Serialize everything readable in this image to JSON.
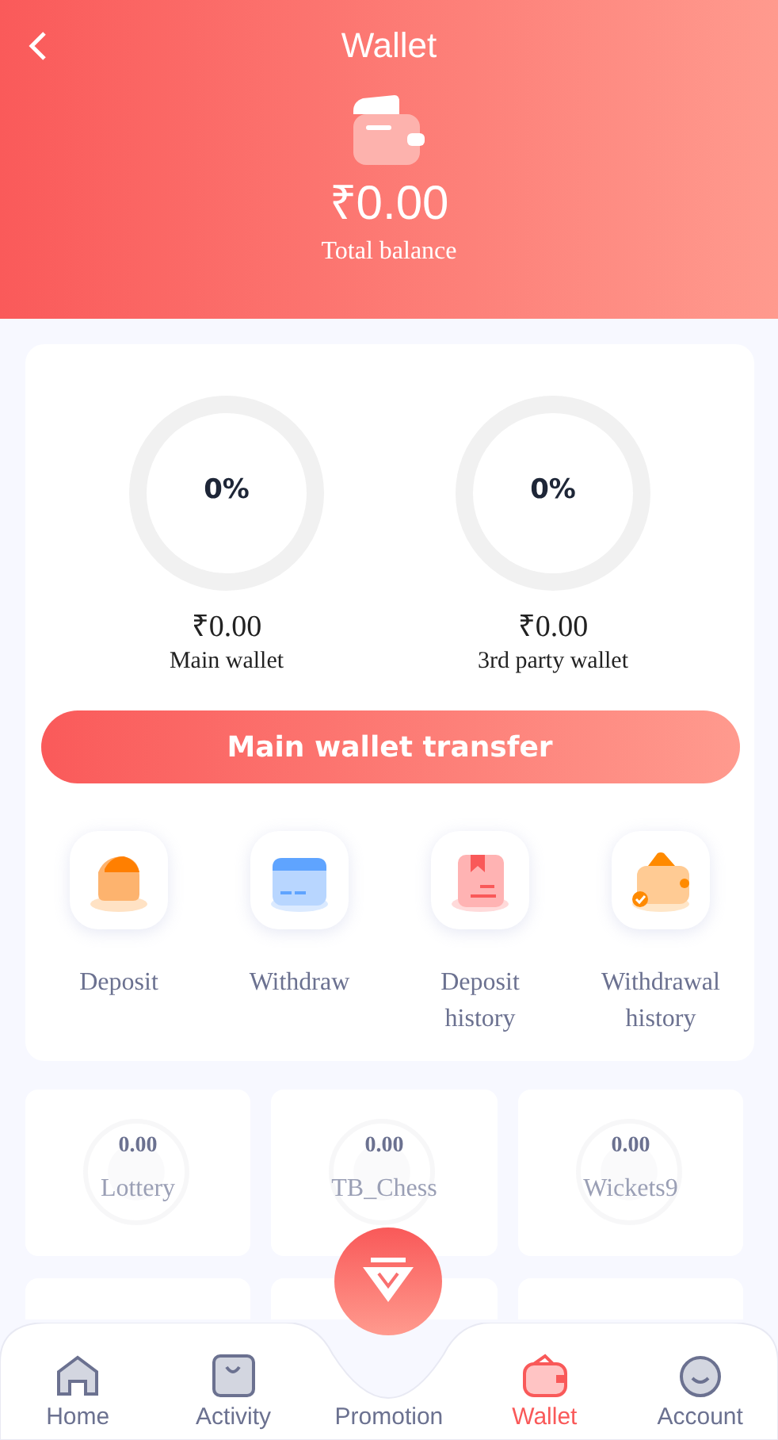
{
  "header": {
    "title": "Wallet",
    "balance": "₹0.00",
    "balance_label": "Total balance"
  },
  "wallets": [
    {
      "percent": "0%",
      "amount": "₹0.00",
      "label": "Main wallet"
    },
    {
      "percent": "0%",
      "amount": "₹0.00",
      "label": "3rd party wallet"
    }
  ],
  "transfer_button": "Main wallet transfer",
  "actions": [
    {
      "kind": "deposit",
      "label": "Deposit"
    },
    {
      "kind": "withdraw",
      "label": "Withdraw"
    },
    {
      "kind": "deposit_history",
      "label": "Deposit history"
    },
    {
      "kind": "withdrawal_history",
      "label": "Withdrawal history"
    }
  ],
  "games": [
    {
      "amount": "0.00",
      "name": "Lottery"
    },
    {
      "amount": "0.00",
      "name": "TB_Chess"
    },
    {
      "amount": "0.00",
      "name": "Wickets9"
    }
  ],
  "nav": [
    {
      "kind": "home",
      "label": "Home",
      "selected": false
    },
    {
      "kind": "activity",
      "label": "Activity",
      "selected": false
    },
    {
      "kind": "promotion",
      "label": "Promotion",
      "selected": false
    },
    {
      "kind": "wallet",
      "label": "Wallet",
      "selected": true
    },
    {
      "kind": "account",
      "label": "Account",
      "selected": false
    }
  ]
}
